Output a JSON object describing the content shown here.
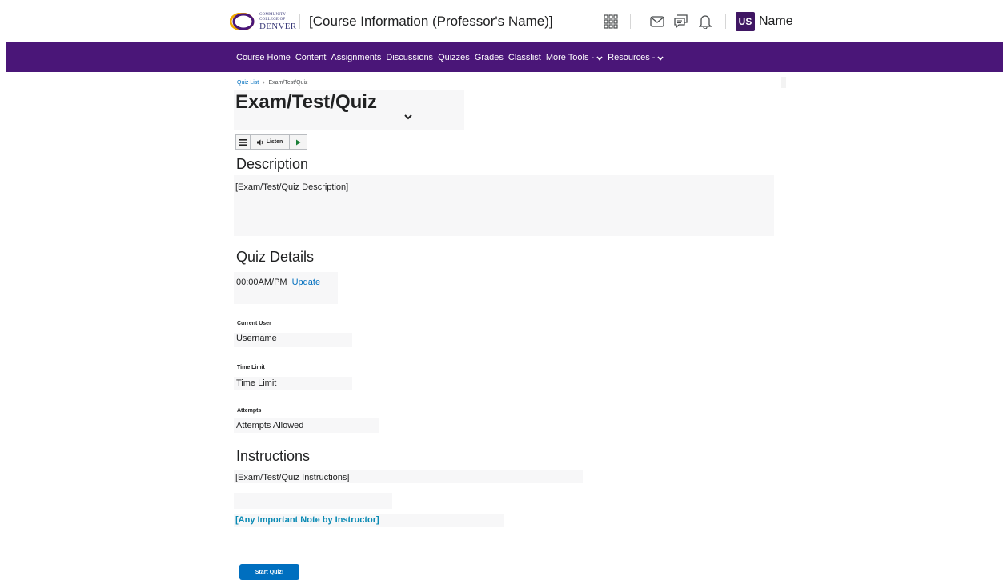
{
  "header": {
    "logo": {
      "line1": "COMMUNITY",
      "line2": "COLLEGE OF",
      "line3": "DENVER"
    },
    "course_title": "[Course Information (Professor's Name)]",
    "icons": [
      "waffle-icon",
      "mail-icon",
      "chat-icon",
      "bell-icon"
    ],
    "user_initials": "US",
    "user_name": "Name"
  },
  "nav": {
    "items": [
      {
        "label": "Course Home"
      },
      {
        "label": "Content"
      },
      {
        "label": "Assignments"
      },
      {
        "label": "Discussions"
      },
      {
        "label": "Quizzes"
      },
      {
        "label": "Grades"
      },
      {
        "label": "Classlist"
      },
      {
        "label": "More Tools -"
      },
      {
        "label": "Resources -"
      }
    ],
    "bg_color": "#4a1678"
  },
  "breadcrumb": {
    "link": "Quiz List",
    "separator": "›",
    "current": "Exam/Test/Quiz"
  },
  "page_title": "Exam/Test/Quiz",
  "listen_bar": {
    "label": "Listen"
  },
  "description": {
    "heading": "Description",
    "text": "[Exam/Test/Quiz Description]"
  },
  "quiz_details": {
    "heading": "Quiz Details",
    "time": "00:00AM/PM",
    "update_label": "Update",
    "current_user_label": "Current User",
    "current_user_value": "Username",
    "time_limit_label": "Time Limit",
    "time_limit_value": "Time Limit",
    "attempts_label": "Attempts",
    "attempts_value": "Attempts Allowed"
  },
  "instructions": {
    "heading": "Instructions",
    "text": "[Exam/Test/Quiz Instructions]",
    "note": "[Any Important Note by Instructor]"
  },
  "start_button": "Start Quiz!",
  "colors": {
    "accent": "#006fbf",
    "brand": "#4a1678",
    "note": "#0a8ab4"
  }
}
